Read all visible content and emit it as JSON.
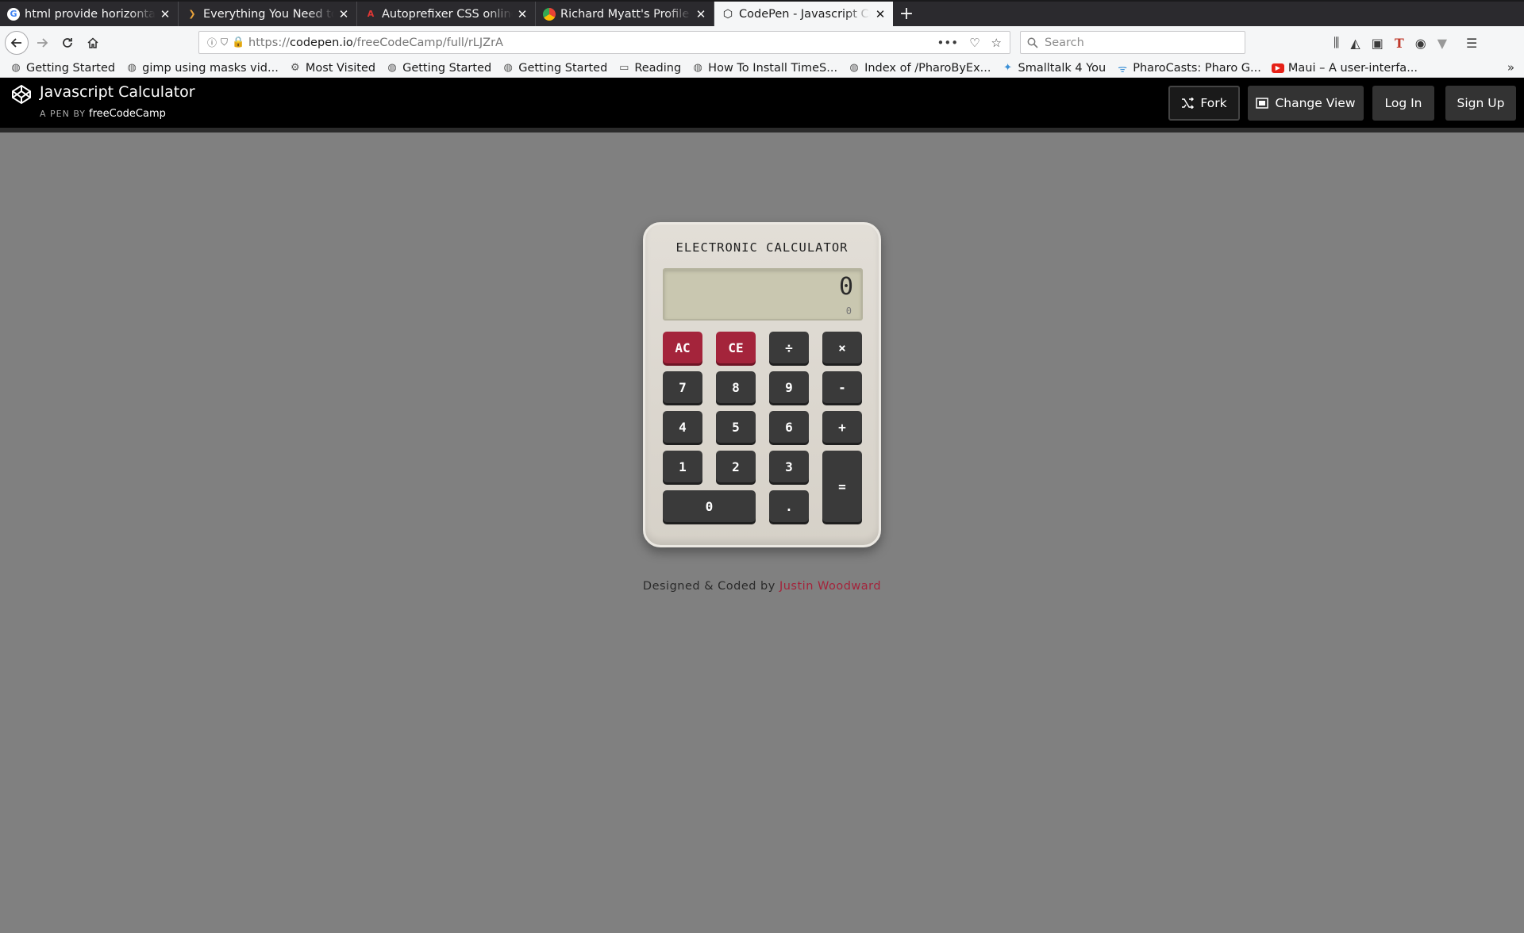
{
  "browser": {
    "tabs": [
      {
        "title": "html provide horizontal",
        "icon": "google-icon",
        "active": false
      },
      {
        "title": "Everything You Need to",
        "icon": "codrops-icon",
        "active": false
      },
      {
        "title": "Autoprefixer CSS online",
        "icon": "autoprefixer-icon",
        "active": false
      },
      {
        "title": "Richard Myatt's Profile",
        "icon": "profile-icon",
        "active": false
      },
      {
        "title": "CodePen - Javascript Ca",
        "icon": "codepen-icon",
        "active": true
      }
    ],
    "new_tab": "+",
    "close_glyph": "✕",
    "url_prefix": "https://",
    "url_domain": "codepen.io",
    "url_path": "/freeCodeCamp/full/rLJZrA",
    "search_placeholder": "Search",
    "bookmarks": [
      "Getting Started",
      "gimp using masks vid...",
      "Most Visited",
      "Getting Started",
      "Getting Started",
      "Reading",
      "How To Install TimeS...",
      "Index of /PharoByEx...",
      "Smalltalk 4 You",
      "PharoCasts: Pharo G...",
      "Maui – A user-interfa..."
    ]
  },
  "codepen": {
    "title": "Javascript Calculator",
    "by_label": "A PEN BY",
    "author": "freeCodeCamp",
    "fork": "Fork",
    "change_view": "Change View",
    "log_in": "Log In",
    "sign_up": "Sign Up"
  },
  "calculator": {
    "brand": "ELECTRONIC CALCULATOR",
    "display": "0",
    "display_sub": "0",
    "keys": {
      "ac": "AC",
      "ce": "CE",
      "divide": "÷",
      "multiply": "×",
      "seven": "7",
      "eight": "8",
      "nine": "9",
      "minus": "-",
      "four": "4",
      "five": "5",
      "six": "6",
      "plus": "+",
      "one": "1",
      "two": "2",
      "three": "3",
      "equals": "=",
      "zero": "0",
      "dot": "."
    }
  },
  "footer": {
    "designed": "Designed & Coded by",
    "author": "Justin Woodward"
  },
  "colors": {
    "page_bg": "#808080",
    "accent_red": "#a4243b",
    "key_dark": "#3a3a3a",
    "screen": "#c9c7b0"
  }
}
